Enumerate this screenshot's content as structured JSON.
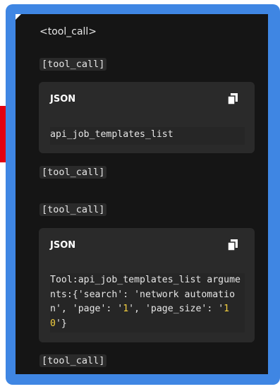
{
  "message": {
    "open_tag": "<tool_call>",
    "tool_call_labels": [
      "[tool_call]",
      "[tool_call]",
      "[tool_call]",
      "[tool_call]"
    ]
  },
  "code_blocks": [
    {
      "language": "JSON",
      "copy_icon": "copy-icon",
      "lines": [
        "api_job_templates_list"
      ]
    },
    {
      "language": "JSON",
      "copy_icon": "copy-icon",
      "segments": {
        "line1": "Tool:api_job_templates_list argume",
        "line2": "nts:{'search': 'network automatio",
        "line3_a": "n', 'page': '",
        "line3_b": "1",
        "line3_c": "', 'page_size': '",
        "line3_d": "1",
        "line4_a": "0",
        "line4_b": "'}"
      }
    }
  ],
  "colors": {
    "frame": "#3f86e3",
    "panel": "#151515",
    "card": "#2a2a2a",
    "accent_red": "#e3000f",
    "string_yellow": "#f4d03f"
  }
}
